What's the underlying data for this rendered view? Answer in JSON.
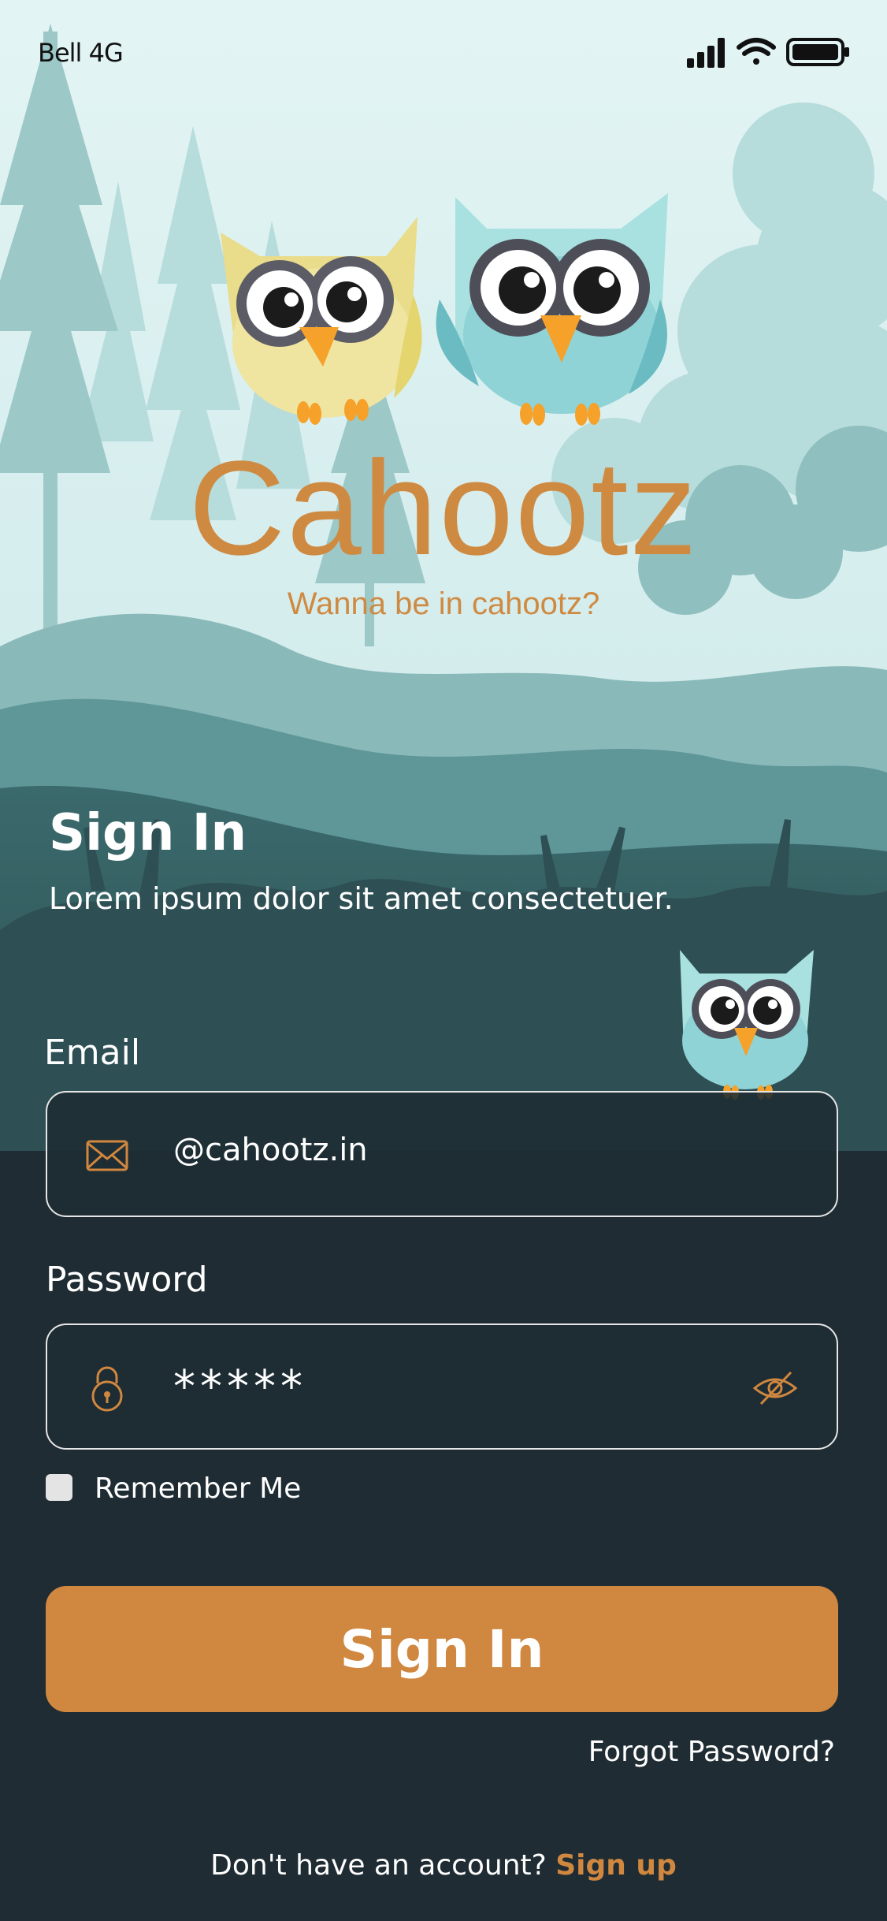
{
  "status_bar": {
    "carrier": "Bell 4G",
    "icons": [
      "signal-icon",
      "wifi-icon",
      "battery-icon"
    ]
  },
  "brand": {
    "name": "Cahootz",
    "tagline": "Wanna be in cahootz?",
    "color": "#cf8a42"
  },
  "header": {
    "title": "Sign In",
    "subtitle": "Lorem ipsum dolor sit amet consectetuer."
  },
  "form": {
    "email": {
      "label": "Email",
      "value": "@cahootz.in",
      "icon": "envelope-icon"
    },
    "password": {
      "label": "Password",
      "value": "*****",
      "icon": "lock-icon",
      "toggle_icon": "eye-slash-icon"
    },
    "remember": {
      "label": "Remember Me",
      "checked": false
    },
    "submit_label": "Sign In",
    "forgot_label": "Forgot Password?"
  },
  "footer": {
    "prompt": "Don't have an account?",
    "link": "Sign up"
  },
  "colors": {
    "accent": "#d0873f",
    "background_dark": "#1f2c33",
    "owl_yellow": "#e9dc8a",
    "owl_teal": "#7ecfd2"
  }
}
